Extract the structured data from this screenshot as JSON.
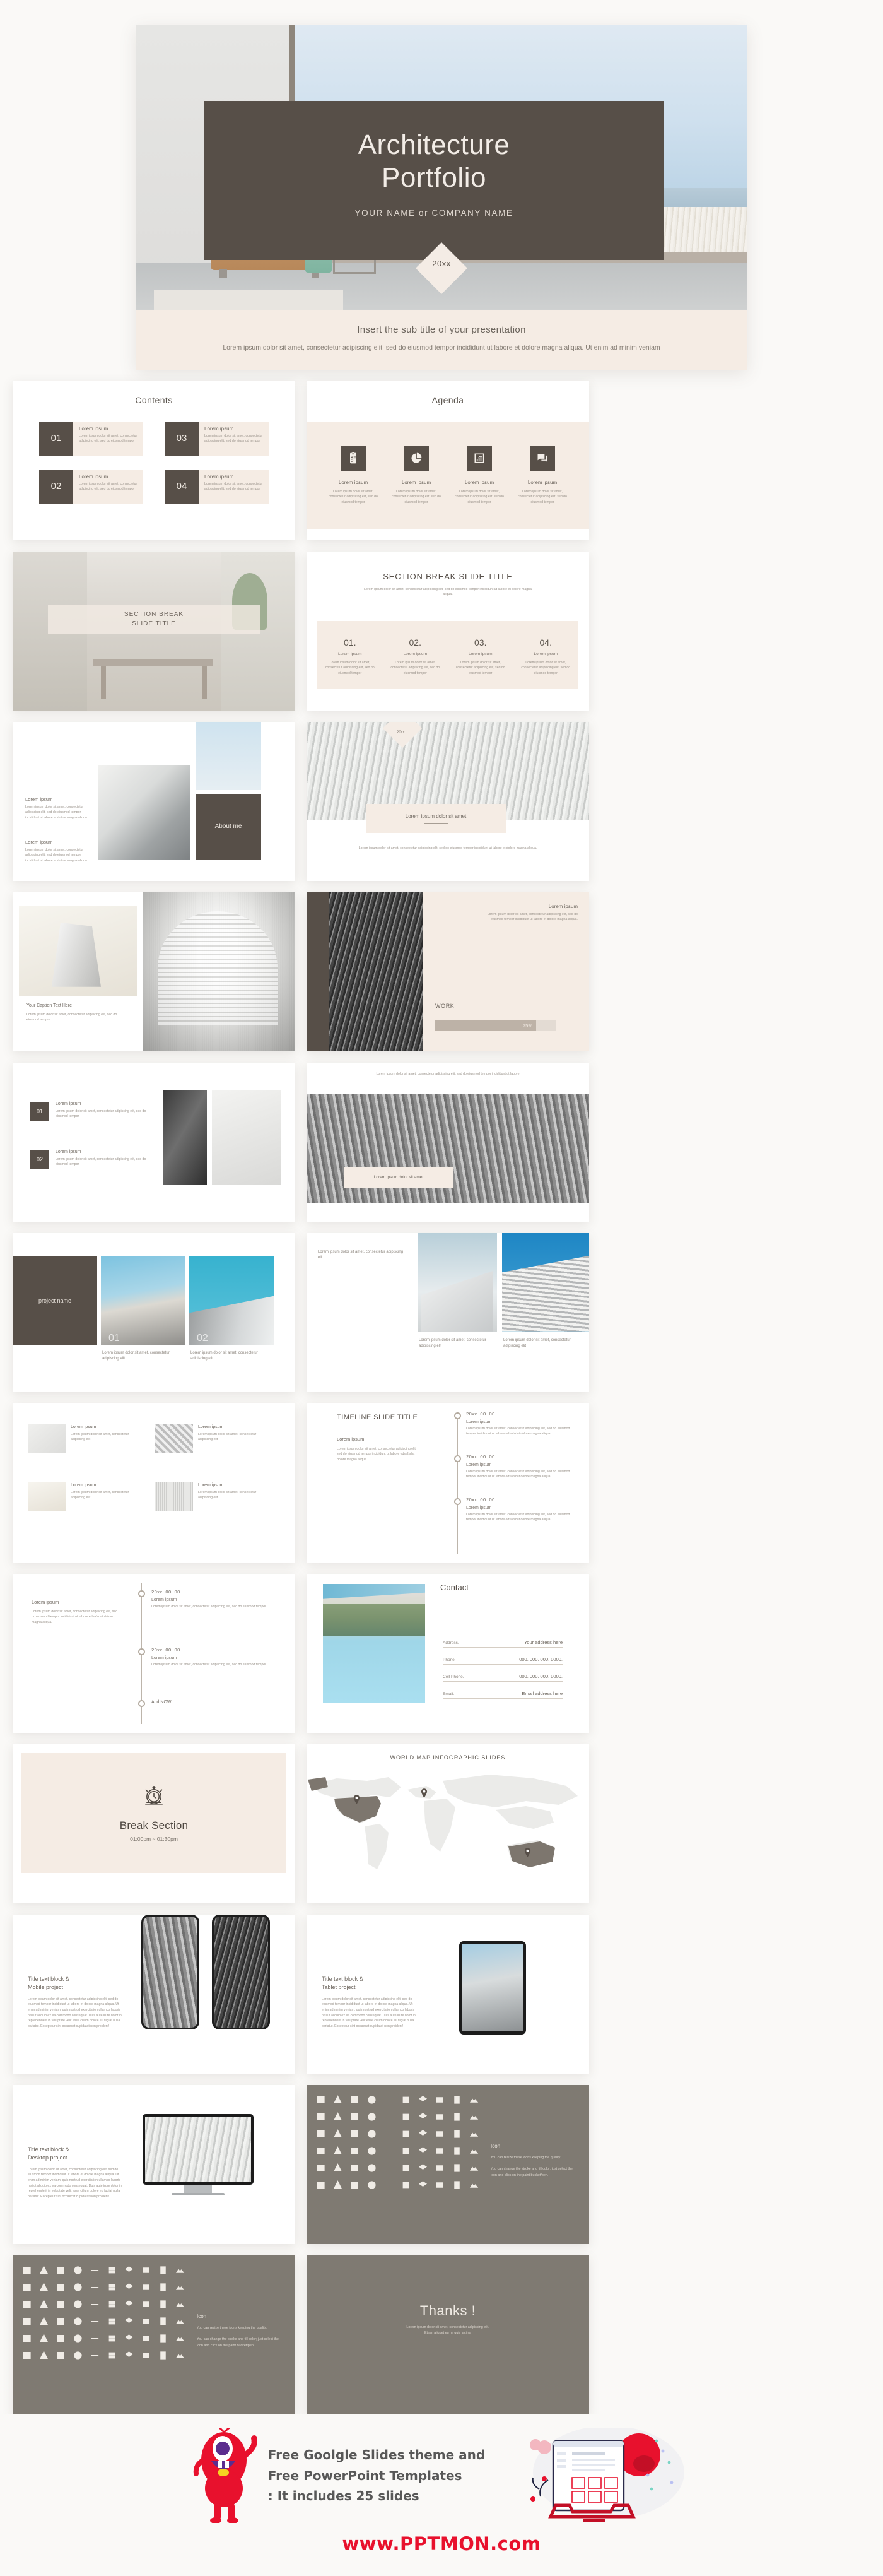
{
  "hero": {
    "title_line1": "Architecture",
    "title_line2": "Portfolio",
    "author": "YOUR NAME or COMPANY NAME",
    "year": "20xx",
    "subtitle": "Insert the sub title of your presentation",
    "body": "Lorem ipsum dolor sit amet, consectetur adipiscing elit, sed do eiusmod tempor incididunt ut labore et dolore magna aliqua. Ut enim ad minim veniam"
  },
  "common": {
    "lorem_ipsum": "Lorem ipsum",
    "lorem_short": "Lorem ipsum dolor sit amet, consectetur adipiscing elit, sed do eiusmod tempor",
    "lorem_med": "Lorem ipsum dolor sit amet, consectetur adipiscing elit, sed do eiusmod tempor incididunt ut labore et dolore magna aliqua.",
    "lorem_two": "Lorem ipsum dolor sit amet, consectetur adipiscing elit",
    "lorem_tl": "Lorem ipsum dolor sit amet, consectetur adipiscing elit, sed do eiusmod tempor incididunt ut labore edsafsdat dolore magna aliqua.",
    "lorem_dolor_sit_amet": "Lorem ipsum dolor sit amet"
  },
  "contents": {
    "title": "Contents",
    "items": [
      {
        "num": "01",
        "head": "Lorem ipsum",
        "body": "Lorem ipsum dolor sit amet, consectetur adipiscing elit, sed do eiusmod tempor"
      },
      {
        "num": "02",
        "head": "Lorem ipsum",
        "body": "Lorem ipsum dolor sit amet, consectetur adipiscing elit, sed do eiusmod tempor"
      },
      {
        "num": "03",
        "head": "Lorem ipsum",
        "body": "Lorem ipsum dolor sit amet, consectetur adipiscing elit, sed do eiusmod tempor"
      },
      {
        "num": "04",
        "head": "Lorem ipsum",
        "body": "Lorem ipsum dolor sit amet, consectetur adipiscing elit, sed do eiusmod tempor"
      }
    ]
  },
  "agenda": {
    "title": "Agenda",
    "items": [
      {
        "icon": "clipboard-list-icon",
        "head": "Lorem ipsum",
        "body": "Lorem ipsum dolor sit amet, consectetur adipiscing elit, sed do eiusmod tempor"
      },
      {
        "icon": "pie-chart-icon",
        "head": "Lorem ipsum",
        "body": "Lorem ipsum dolor sit amet, consectetur adipiscing elit, sed do eiusmod tempor"
      },
      {
        "icon": "bar-chart-growth-icon",
        "head": "Lorem ipsum",
        "body": "Lorem ipsum dolor sit amet, consectetur adipiscing elit, sed do eiusmod tempor"
      },
      {
        "icon": "chat-bubbles-icon",
        "head": "Lorem ipsum",
        "body": "Lorem ipsum dolor sit amet, consectetur adipiscing elit, sed do eiusmod tempor"
      }
    ]
  },
  "section_break_photo": {
    "title": "SECTION BREAK\nSLIDE TITLE"
  },
  "section_break_4": {
    "title": "SECTION BREAK SLIDE TITLE",
    "subtitle": "Lorem ipsum dolor sit amet, consectetur adipiscing elit, sed do eiusmod tempor incididunt ut labore et dolore magna aliqua.",
    "items": [
      {
        "num": "01.",
        "head": "Lorem ipsum",
        "body": "Lorem ipsum dolor sit amet, consectetur adipiscing elit, sed do eiusmod tempor"
      },
      {
        "num": "02.",
        "head": "Lorem ipsum",
        "body": "Lorem ipsum dolor sit amet, consectetur adipiscing elit, sed do eiusmod tempor"
      },
      {
        "num": "03.",
        "head": "Lorem ipsum",
        "body": "Lorem ipsum dolor sit amet, consectetur adipiscing elit, sed do eiusmod tempor"
      },
      {
        "num": "04.",
        "head": "Lorem ipsum",
        "body": "Lorem ipsum dolor sit amet, consectetur adipiscing elit, sed do eiusmod tempor"
      }
    ]
  },
  "about_me": {
    "badge": "About me",
    "block1_head": "Lorem ipsum",
    "block1_body": "Lorem ipsum dolor sit amet, consectetur adipiscing elit, sed do eiusmod tempor incididunt ut labore et dolore magna aliqua.",
    "block2_head": "Lorem ipsum",
    "block2_body": "Lorem ipsum dolor sit amet, consectetur adipiscing elit, sed do eiusmod tempor incididunt ut labore et dolore magna aliqua."
  },
  "photo_band_slide": {
    "year": "20xx",
    "band_text": "Lorem ipsum dolor sit amet",
    "caption": "Lorem ipsum dolor sit amet, consectetur adipiscing elit, sed do eiusmod tempor incididunt ut labore et dolore magna aliqua."
  },
  "image_caption_slide": {
    "caption_head": "Your Caption Text Here",
    "caption_body": "Lorem ipsum dolor sit amet, consectetur adipiscing elit, sed do eiusmod tempor"
  },
  "work_slide": {
    "head": "Lorem ipsum",
    "body": "Lorem ipsum dolor sit amet, consectetur adipiscing elit, sed do eiusmod tempor incididunt ut labore et dolore magna aliqua.",
    "label": "WORK",
    "percent": "75%",
    "percent_value": 75
  },
  "numbered_photo_slide": {
    "items": [
      {
        "num": "01",
        "head": "Lorem ipsum",
        "body": "Lorem ipsum dolor sit amet, consectetur adipiscing elit, sed do eiusmod tempor"
      },
      {
        "num": "02",
        "head": "Lorem ipsum",
        "body": "Lorem ipsum dolor sit amet, consectetur adipiscing elit, sed do eiusmod tempor"
      }
    ]
  },
  "wide_photo_slide": {
    "top_caption": "Lorem ipsum dolor sit amet, consectetur adipiscing elit, sed do eiusmod tempor incididunt ut labore",
    "band_text": "Lorem ipsum dolor sit amet"
  },
  "project_slide": {
    "project_name": "project name",
    "items": [
      {
        "num": "01",
        "caption": "Lorem ipsum dolor sit amet, consectetur adipiscing elit"
      },
      {
        "num": "02",
        "caption": "Lorem ipsum dolor sit amet, consectetur adipiscing elit"
      }
    ]
  },
  "two_photo_slide": {
    "top_text": "Lorem ipsum dolor sit amet, consectetur adipiscing elit",
    "cap_left": "Lorem ipsum dolor sit amet, consectetur adipiscing elit",
    "cap_right": "Lorem ipsum dolor sit amet, consectetur adipiscing elit"
  },
  "materials_slide": {
    "items": [
      {
        "head": "Lorem ipsum",
        "body": "Lorem ipsum dolor sit amet, consectetur adipiscing elit"
      },
      {
        "head": "Lorem ipsum",
        "body": "Lorem ipsum dolor sit amet, consectetur adipiscing elit"
      },
      {
        "head": "Lorem ipsum",
        "body": "Lorem ipsum dolor sit amet, consectetur adipiscing elit"
      },
      {
        "head": "Lorem ipsum",
        "body": "Lorem ipsum dolor sit amet, consectetur adipiscing elit"
      }
    ]
  },
  "timeline_slide": {
    "title": "TIMELINE SLIDE TITLE",
    "left_head": "Lorem ipsum",
    "left_body": "Lorem ipsum dolor sit amet, consectetur adipiscing elit, sed do eiusmod tempor incididunt ut labore edsafsdat dolore magna aliqua.",
    "items": [
      {
        "date": "20xx. 00. 00",
        "head": "Lorem ipsum",
        "body": "Lorem ipsum dolor sit amet, consectetur adipiscing elit, sed do eiusmod tempor incididunt ut labore edsafsdat dolore magna aliqua."
      },
      {
        "date": "20xx. 00. 00",
        "head": "Lorem ipsum",
        "body": "Lorem ipsum dolor sit amet, consectetur adipiscing elit, sed do eiusmod tempor incididunt ut labore edsafsdat dolore magna aliqua."
      },
      {
        "date": "20xx. 00. 00",
        "head": "Lorem ipsum",
        "body": "Lorem ipsum dolor sit amet, consectetur adipiscing elit, sed do eiusmod tempor incididunt ut labore edsafsdat dolore magna aliqua."
      }
    ]
  },
  "timeline_slide2": {
    "left_head": "Lorem ipsum",
    "left_body": "Lorem ipsum dolor sit amet, consectetur adipiscing elit, sed do eiusmod tempor incididunt ut labore edsafsdat dolore magna aliqua.",
    "end_label": "And NOW !",
    "items": [
      {
        "date": "20xx. 00. 00",
        "head": "Lorem ipsum",
        "body": "Lorem ipsum dolor sit amet, consectetur adipiscing elit, sed do eiusmod tempor"
      },
      {
        "date": "20xx. 00. 00",
        "head": "Lorem ipsum",
        "body": "Lorem ipsum dolor sit amet, consectetur adipiscing elit, sed do eiusmod tempor"
      }
    ]
  },
  "contact": {
    "title": "Contact",
    "rows": [
      {
        "key": "Address.",
        "value": "Your address here"
      },
      {
        "key": "Phone.",
        "value": "000. 000. 000. 0000."
      },
      {
        "key": "Cell Phone.",
        "value": "000. 000. 000. 0000."
      },
      {
        "key": "Email.",
        "value": "Email address here"
      }
    ]
  },
  "break_section": {
    "icon": "alarm-clock-icon",
    "title": "Break Section",
    "time": "01:00pm ~ 01:30pm"
  },
  "world_map": {
    "title": "WORLD MAP INFOGRAPHIC SLIDES",
    "pins": [
      {
        "name": "pin-north-america"
      },
      {
        "name": "pin-europe"
      },
      {
        "name": "pin-australia"
      }
    ]
  },
  "mockups": [
    {
      "head_line1": "Title text block &",
      "head_line2": "Mobile project",
      "body": "Lorem ipsum dolor sit amet, consectetur adipiscing elit, sed do eiusmod tempor incididunt ut labore et dolore magna aliqua. Ut enim ad minim veniam, quis nostrud exercitation ullamco laboris nisi ut aliquip ex ea commodo consequat. Duis aute irure dolor in reprehenderit in voluptate velit esse cillum dolore eu fugiat nulla pariatur. Excepteur sint occaecat cupidatat non proident!"
    },
    {
      "head_line1": "Title text block &",
      "head_line2": "Tablet project",
      "body": "Lorem ipsum dolor sit amet, consectetur adipiscing elit, sed do eiusmod tempor incididunt ut labore et dolore magna aliqua. Ut enim ad minim veniam, quis nostrud exercitation ullamco laboris nisi ut aliquip ex ea commodo consequat. Duis aute irure dolor in reprehenderit in voluptate velit esse cillum dolore eu fugiat nulla pariatur. Excepteur sint occaecat cupidatat non proident!"
    },
    {
      "head_line1": "Title text block &",
      "head_line2": "Desktop project",
      "body": "Lorem ipsum dolor sit amet, consectetur adipiscing elit, sed do eiusmod tempor incididunt ut labore et dolore magna aliqua. Ut enim ad minim veniam, quis nostrud exercitation ullamco laboris nisi ut aliquip ex ea commodo consequat. Duis aute irure dolor in reprehenderit in voluptate velit esse cillum dolore eu fugiat nulla pariatur. Excepteur sint occaecat cupidatat non proident!"
    }
  ],
  "icon_sheet": {
    "head": "Icon",
    "p1": "You can resize these icons keeping the quality.",
    "p2": "You can change the stroke and fill color; just select the icon and click on the paint bucket/pen."
  },
  "thanks": {
    "title": "Thanks !",
    "body": "Lorem ipsum dolor sit amet, consectetur adipiscing elit. Etiam aliquet eu mi quis lacinia"
  },
  "footer": {
    "line1": "Free Goolgle Slides theme and",
    "line2": "Free PowerPoint Templates",
    "line3": ": It includes 25 slides",
    "url": "www.PPTMON.com"
  },
  "colors": {
    "dark_brown": "#574f48",
    "cream": "#f5ece4",
    "gray_brown": "#7f7a72",
    "red": "#e8112d",
    "page_bg": "#faf9f7"
  }
}
